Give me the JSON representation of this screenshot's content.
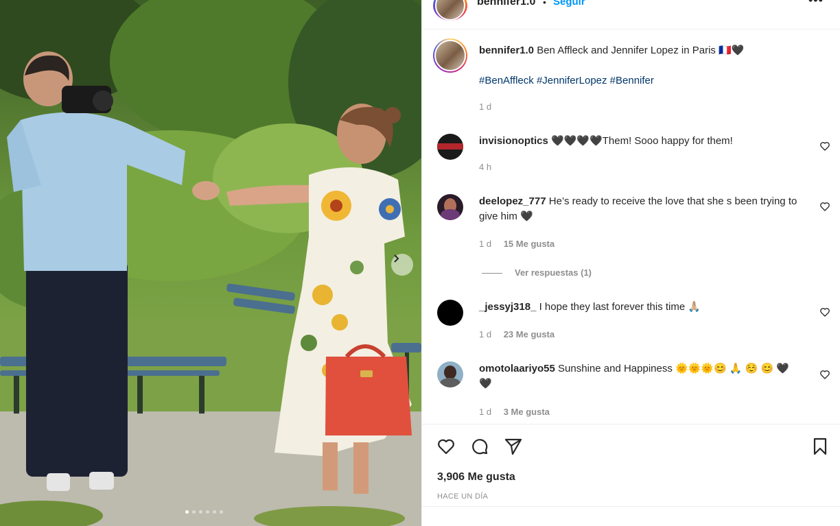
{
  "header": {
    "username": "bennifer1.0",
    "separator": "•",
    "follow_label": "Seguir",
    "more_label": "•••"
  },
  "caption": {
    "username": "bennifer1.0",
    "text": "Ben Affleck and Jennifer Lopez in Paris 🇫🇷🖤",
    "hashtags": "#BenAffleck #JenniferLopez #Bennifer",
    "time": "1 d"
  },
  "comments": [
    {
      "username": "invisionoptics",
      "text": "🖤🖤🖤🖤Them! Sooo happy for them!",
      "time": "4 h",
      "likes": ""
    },
    {
      "username": "deelopez_777",
      "text": "He’s ready to receive the love that she s been trying to give him 🖤",
      "time": "1 d",
      "likes": "15 Me gusta"
    },
    {
      "username": "_jessyj318_",
      "text": "I hope they last forever this time 🙏🏼",
      "time": "1 d",
      "likes": "23 Me gusta"
    },
    {
      "username": "omotolaariyo55",
      "text": "Sunshine and Happiness 🌞🌞🌞😊 🙏 ☺️ 😊 🖤🖤",
      "time": "1 d",
      "likes": "3 Me gusta"
    }
  ],
  "view_replies": "Ver respuestas (1)",
  "actions": {
    "like_icon": "heart-icon",
    "comment_icon": "comment-icon",
    "share_icon": "send-icon",
    "save_icon": "bookmark-icon"
  },
  "likes_total": "3,906 Me gusta",
  "post_time": "HACE UN DÍA",
  "carousel": {
    "slide_count": 6,
    "active_index": 0
  },
  "colors": {
    "follow": "#0095f6",
    "hashtag": "#00376b",
    "muted": "#8e8e8e",
    "text": "#262626"
  }
}
